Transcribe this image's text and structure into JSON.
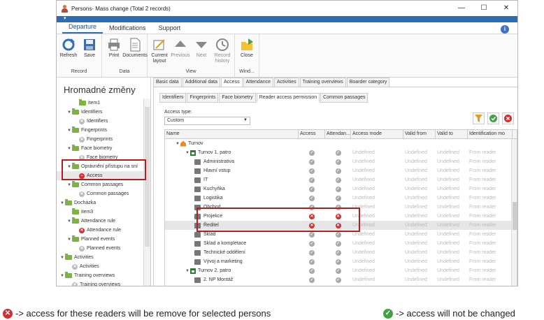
{
  "window": {
    "title": "Persons- Mass change (Total 2 records)"
  },
  "window_controls": {
    "minimize": "—",
    "maximize": "☐",
    "close": "✕"
  },
  "qat": {
    "arrow": "▾"
  },
  "ribbon_tabs": [
    "Departure",
    "Modifications",
    "Support"
  ],
  "help_icon_text": "i",
  "ribbon": {
    "groups": [
      {
        "label": "Record",
        "buttons": [
          {
            "label": "Refresh",
            "icon": "refresh-icon"
          },
          {
            "label": "Save",
            "icon": "save-icon"
          }
        ]
      },
      {
        "label": "Data",
        "buttons": [
          {
            "label": "Print",
            "icon": "print-icon"
          },
          {
            "label": "Documents",
            "icon": "documents-icon"
          }
        ]
      },
      {
        "label": "View",
        "buttons": [
          {
            "label": "Current layout",
            "icon": "layout-icon"
          },
          {
            "label": "Previous",
            "icon": "up-arrow-icon"
          },
          {
            "label": "Next",
            "icon": "down-arrow-icon"
          },
          {
            "label": "Record history",
            "icon": "history-icon"
          }
        ]
      },
      {
        "label": "Wind...",
        "buttons": [
          {
            "label": "Close",
            "icon": "close-folder-icon"
          }
        ]
      }
    ]
  },
  "left_panel": {
    "title": "Hromadné změny",
    "tree": [
      {
        "label": "item1",
        "level": 2,
        "type": "folder"
      },
      {
        "label": "Identifiers",
        "level": 1,
        "type": "folder",
        "expanded": true
      },
      {
        "label": "Identifiers",
        "level": 2,
        "type": "gray"
      },
      {
        "label": "Fingerprints",
        "level": 1,
        "type": "folder",
        "expanded": true
      },
      {
        "label": "Fingerprints",
        "level": 2,
        "type": "gray"
      },
      {
        "label": "Face biometry",
        "level": 1,
        "type": "folder",
        "expanded": true
      },
      {
        "label": "Face biometry",
        "level": 2,
        "type": "gray"
      },
      {
        "label": "Oprávnění přístupu na sní",
        "level": 1,
        "type": "folder",
        "expanded": true
      },
      {
        "label": "Access",
        "level": 2,
        "type": "redbar",
        "selected": true
      },
      {
        "label": "Common passages",
        "level": 1,
        "type": "folder",
        "expanded": true
      },
      {
        "label": "Common passages",
        "level": 2,
        "type": "gray"
      },
      {
        "label": "Docházka",
        "level": 0,
        "type": "folder",
        "expanded": true
      },
      {
        "label": "item3",
        "level": 1,
        "type": "folder"
      },
      {
        "label": "Attendance rule",
        "level": 1,
        "type": "folder",
        "expanded": true
      },
      {
        "label": "Attendance rule",
        "level": 2,
        "type": "red"
      },
      {
        "label": "Planned events",
        "level": 1,
        "type": "folder",
        "expanded": true
      },
      {
        "label": "Planned events",
        "level": 2,
        "type": "gray"
      },
      {
        "label": "Activities",
        "level": 0,
        "type": "folder",
        "expanded": true
      },
      {
        "label": "Activities",
        "level": 1,
        "type": "gray"
      },
      {
        "label": "Training overviews",
        "level": 0,
        "type": "folder",
        "expanded": true
      },
      {
        "label": "Training overviews",
        "level": 1,
        "type": "gray"
      }
    ]
  },
  "tabs_row1": [
    "Basic data",
    "Additional data",
    "Access",
    "Attendance",
    "Activities",
    "Training overviews",
    "Boarder category"
  ],
  "tabs_row1_active": 2,
  "tabs_row2": [
    "Identifiers",
    "Fingerprints",
    "Face biometry",
    "Reader access permission",
    "Common passages"
  ],
  "tabs_row2_active": 3,
  "access_type": {
    "label": "Access type:",
    "value": "Custom"
  },
  "toolbar_icons": [
    "filter-icon",
    "confirm-icon",
    "cancel-icon"
  ],
  "grid": {
    "columns": [
      "Name",
      "Access",
      "Attendan...",
      "Access mode",
      "Valid from",
      "Valid to",
      "Identification mo"
    ],
    "rows": [
      {
        "name": "Turnov",
        "indent": 1,
        "icon": "home",
        "acc": "",
        "att": "",
        "mode": "",
        "vf": "",
        "vt": "",
        "idm": ""
      },
      {
        "name": "Turnov 1. patro",
        "indent": 2,
        "icon": "net",
        "acc": "ok",
        "att": "ok",
        "mode": "Undefined",
        "vf": "Undefined",
        "vt": "Undefined",
        "idm": "From reader"
      },
      {
        "name": "Administrativa",
        "indent": 3,
        "icon": "reader",
        "acc": "ok",
        "att": "ok",
        "mode": "Undefined",
        "vf": "Undefined",
        "vt": "Undefined",
        "idm": "From reader"
      },
      {
        "name": "Hlavní vstup",
        "indent": 3,
        "icon": "reader",
        "acc": "ok",
        "att": "ok",
        "mode": "Undefined",
        "vf": "Undefined",
        "vt": "Undefined",
        "idm": "From reader"
      },
      {
        "name": "IT",
        "indent": 3,
        "icon": "reader",
        "acc": "ok",
        "att": "ok",
        "mode": "Undefined",
        "vf": "Undefined",
        "vt": "Undefined",
        "idm": "From reader"
      },
      {
        "name": "Kuchyňka",
        "indent": 3,
        "icon": "reader",
        "acc": "ok",
        "att": "ok",
        "mode": "Undefined",
        "vf": "Undefined",
        "vt": "Undefined",
        "idm": "From reader"
      },
      {
        "name": "Logistika",
        "indent": 3,
        "icon": "reader",
        "acc": "ok",
        "att": "ok",
        "mode": "Undefined",
        "vf": "Undefined",
        "vt": "Undefined",
        "idm": "From reader"
      },
      {
        "name": "Obchod",
        "indent": 3,
        "icon": "reader",
        "acc": "ok",
        "att": "ok",
        "mode": "Undefined",
        "vf": "Undefined",
        "vt": "Undefined",
        "idm": "From reader"
      },
      {
        "name": "Projekce",
        "indent": 3,
        "icon": "reader",
        "acc": "x",
        "att": "x",
        "mode": "Undefined",
        "vf": "Undefined",
        "vt": "Undefined",
        "idm": "From reader"
      },
      {
        "name": "Ředitel",
        "indent": 3,
        "icon": "reader",
        "acc": "x",
        "att": "x",
        "mode": "Undefined",
        "vf": "Undefined",
        "vt": "Undefined",
        "idm": "From reader",
        "selected": true
      },
      {
        "name": "Sklad",
        "indent": 3,
        "icon": "reader",
        "acc": "ok",
        "att": "ok",
        "mode": "Undefined",
        "vf": "Undefined",
        "vt": "Undefined",
        "idm": "From reader"
      },
      {
        "name": "Sklad a kompletace",
        "indent": 3,
        "icon": "reader",
        "acc": "ok",
        "att": "ok",
        "mode": "Undefined",
        "vf": "Undefined",
        "vt": "Undefined",
        "idm": "From reader"
      },
      {
        "name": "Technické oddělení",
        "indent": 3,
        "icon": "reader",
        "acc": "ok",
        "att": "ok",
        "mode": "Undefined",
        "vf": "Undefined",
        "vt": "Undefined",
        "idm": "From reader"
      },
      {
        "name": "Vývoj a marketing",
        "indent": 3,
        "icon": "reader",
        "acc": "ok",
        "att": "ok",
        "mode": "Undefined",
        "vf": "Undefined",
        "vt": "Undefined",
        "idm": "From reader"
      },
      {
        "name": "Turnov 2. patro",
        "indent": 2,
        "icon": "net",
        "acc": "ok",
        "att": "ok",
        "mode": "Undefined",
        "vf": "Undefined",
        "vt": "Undefined",
        "idm": "From reader"
      },
      {
        "name": "2. NP Montáž",
        "indent": 3,
        "icon": "reader",
        "acc": "ok",
        "att": "ok",
        "mode": "Undefined",
        "vf": "Undefined",
        "vt": "Undefined",
        "idm": "From reader"
      }
    ]
  },
  "legend": {
    "remove_text": "-> access for these readers will be remove for selected persons",
    "keep_text": "-> access will not be changed"
  },
  "colors": {
    "red": "#d32f2f",
    "green": "#43a047",
    "accent": "#2b6cb3",
    "highlight_box": "#b31d1d"
  }
}
